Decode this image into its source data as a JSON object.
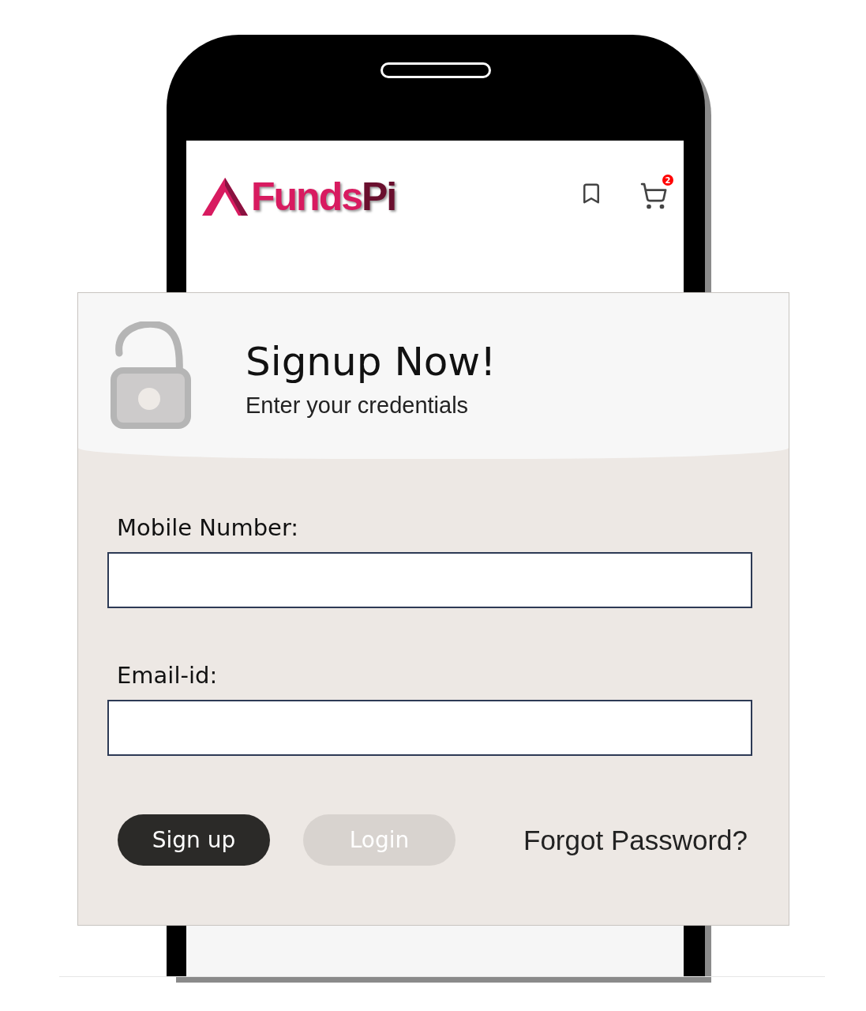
{
  "app_header": {
    "logo": {
      "parts": [
        "Funds",
        "Pi"
      ]
    },
    "cart_badge": "2"
  },
  "signup_card": {
    "title": "Signup Now!",
    "subtitle": "Enter your credentials",
    "fields": [
      {
        "label": "Mobile Number:"
      },
      {
        "label": "Email-id:"
      }
    ],
    "buttons": [
      {
        "label": "Sign up",
        "selected": true
      },
      {
        "label": "Login",
        "selected": false
      }
    ],
    "forgot_link": "Forgot Password?"
  }
}
